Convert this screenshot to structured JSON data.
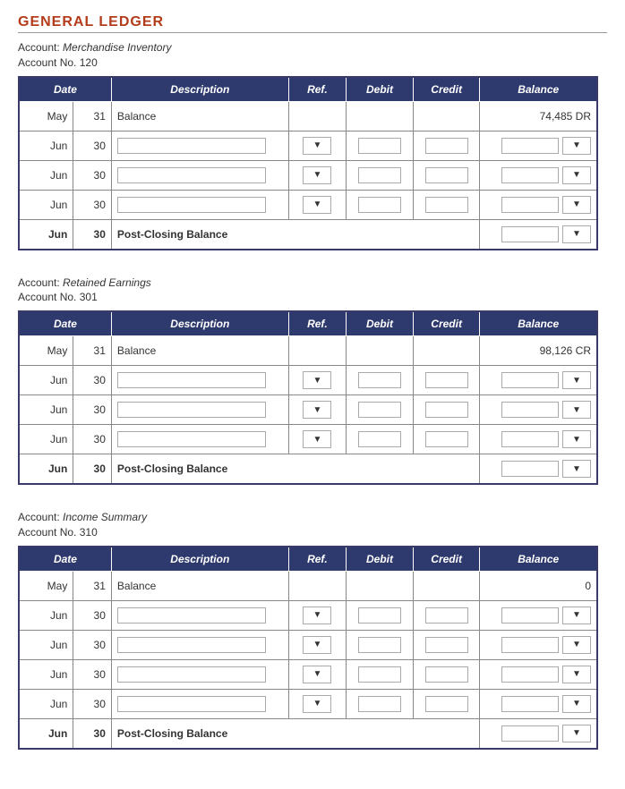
{
  "pageTitle": "GENERAL LEDGER",
  "labels": {
    "account": "Account:",
    "accountNo": "Account No."
  },
  "columns": {
    "date": "Date",
    "description": "Description",
    "ref": "Ref.",
    "debit": "Debit",
    "credit": "Credit",
    "balance": "Balance"
  },
  "accounts": [
    {
      "name": "Merchandise Inventory",
      "number": "120",
      "rows": [
        {
          "month": "May",
          "day": "31",
          "description": "Balance",
          "ref": "",
          "debit": "",
          "credit": "",
          "balance": "74,485 DR",
          "type": "static"
        },
        {
          "month": "Jun",
          "day": "30",
          "type": "input"
        },
        {
          "month": "Jun",
          "day": "30",
          "type": "input"
        },
        {
          "month": "Jun",
          "day": "30",
          "type": "input"
        }
      ],
      "footer": {
        "month": "Jun",
        "day": "30",
        "description": "Post-Closing Balance"
      }
    },
    {
      "name": "Retained Earnings",
      "number": "301",
      "rows": [
        {
          "month": "May",
          "day": "31",
          "description": "Balance",
          "ref": "",
          "debit": "",
          "credit": "",
          "balance": "98,126 CR",
          "type": "static"
        },
        {
          "month": "Jun",
          "day": "30",
          "type": "input"
        },
        {
          "month": "Jun",
          "day": "30",
          "type": "input"
        },
        {
          "month": "Jun",
          "day": "30",
          "type": "input"
        }
      ],
      "footer": {
        "month": "Jun",
        "day": "30",
        "description": "Post-Closing Balance"
      }
    },
    {
      "name": "Income Summary",
      "number": "310",
      "rows": [
        {
          "month": "May",
          "day": "31",
          "description": "Balance",
          "ref": "",
          "debit": "",
          "credit": "",
          "balance": "0",
          "type": "static"
        },
        {
          "month": "Jun",
          "day": "30",
          "type": "input"
        },
        {
          "month": "Jun",
          "day": "30",
          "type": "input"
        },
        {
          "month": "Jun",
          "day": "30",
          "type": "input"
        },
        {
          "month": "Jun",
          "day": "30",
          "type": "input"
        }
      ],
      "footer": {
        "month": "Jun",
        "day": "30",
        "description": "Post-Closing Balance"
      }
    }
  ]
}
